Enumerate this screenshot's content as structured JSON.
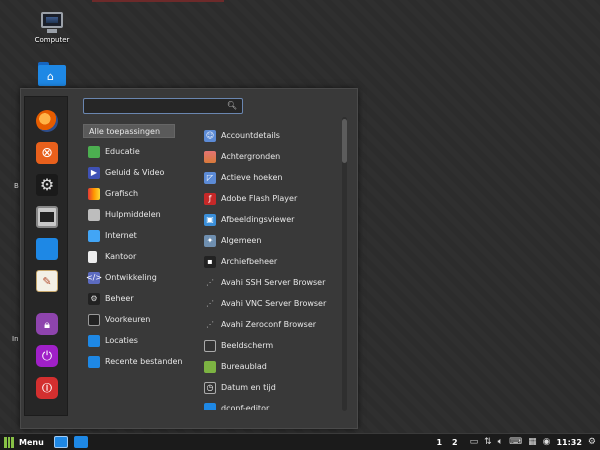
{
  "desktop": {
    "icons": [
      {
        "label": "Computer",
        "icon": "computer-icon"
      },
      {
        "label": "",
        "icon": "home-folder-icon"
      }
    ],
    "edge_labels": [
      "B",
      "In"
    ]
  },
  "menu": {
    "search": {
      "value": "",
      "placeholder": ""
    },
    "favorites": [
      {
        "name": "firefox",
        "icon": "firefox-icon"
      },
      {
        "name": "software-manager",
        "icon": "software-manager-icon"
      },
      {
        "name": "system-settings",
        "icon": "settings-icon"
      },
      {
        "name": "terminal",
        "icon": "terminal-icon"
      },
      {
        "name": "files",
        "icon": "folder-icon"
      },
      {
        "name": "text-editor",
        "icon": "text-editor-icon"
      },
      {
        "name": "lock-screen",
        "icon": "lock-icon"
      },
      {
        "name": "logout",
        "icon": "logout-icon"
      },
      {
        "name": "quit",
        "icon": "power-icon"
      }
    ],
    "categories": [
      {
        "label": "Alle toepassingen",
        "selected": true
      },
      {
        "label": "Educatie",
        "icon": "education-icon",
        "color": "#4caf50"
      },
      {
        "label": "Geluid & Video",
        "icon": "multimedia-icon",
        "color": "#3f51b5"
      },
      {
        "label": "Grafisch",
        "icon": "graphics-icon",
        "color": "#ff9800"
      },
      {
        "label": "Hulpmiddelen",
        "icon": "accessories-icon",
        "color": "#bdbdbd"
      },
      {
        "label": "Internet",
        "icon": "internet-icon",
        "color": "#42a5f5"
      },
      {
        "label": "Kantoor",
        "icon": "office-icon",
        "color": "#eeeeee"
      },
      {
        "label": "Ontwikkeling",
        "icon": "development-icon",
        "color": "#5c6bc0"
      },
      {
        "label": "Beheer",
        "icon": "administration-icon",
        "color": "#222222"
      },
      {
        "label": "Voorkeuren",
        "icon": "preferences-icon",
        "color": "#222222"
      },
      {
        "label": "Locaties",
        "icon": "places-icon",
        "color": "#1e88e5"
      },
      {
        "label": "Recente bestanden",
        "icon": "recent-files-icon",
        "color": "#1e88e5"
      }
    ],
    "apps": [
      {
        "label": "Accountdetails",
        "icon": "account-icon",
        "color": "#5c8bd6"
      },
      {
        "label": "Achtergronden",
        "icon": "backgrounds-icon",
        "color": "#d87a3a"
      },
      {
        "label": "Actieve hoeken",
        "icon": "hot-corners-icon",
        "color": "#5c8bd6"
      },
      {
        "label": "Adobe Flash Player",
        "icon": "flash-icon",
        "color": "#c62828"
      },
      {
        "label": "Afbeeldingsviewer",
        "icon": "image-viewer-icon",
        "color": "#3b8fd9"
      },
      {
        "label": "Algemeen",
        "icon": "general-icon",
        "color": "#6f8fb0"
      },
      {
        "label": "Archiefbeheer",
        "icon": "archive-icon",
        "color": "#222222"
      },
      {
        "label": "Avahi SSH Server Browser",
        "icon": "network-icon",
        "color": "#393939"
      },
      {
        "label": "Avahi VNC Server Browser",
        "icon": "network-icon",
        "color": "#393939"
      },
      {
        "label": "Avahi Zeroconf Browser",
        "icon": "network-icon",
        "color": "#393939"
      },
      {
        "label": "Beeldscherm",
        "icon": "display-icon",
        "color": "#333333"
      },
      {
        "label": "Bureaublad",
        "icon": "desktop-icon",
        "color": "#7cb342"
      },
      {
        "label": "Datum en tijd",
        "icon": "date-time-icon",
        "color": "#333333"
      },
      {
        "label": "dconf-editor",
        "icon": "dconf-icon",
        "color": "#1e88e5"
      }
    ]
  },
  "taskbar": {
    "menu_label": "Menu",
    "workspaces": [
      "1",
      "2"
    ],
    "clock": "11:32"
  }
}
